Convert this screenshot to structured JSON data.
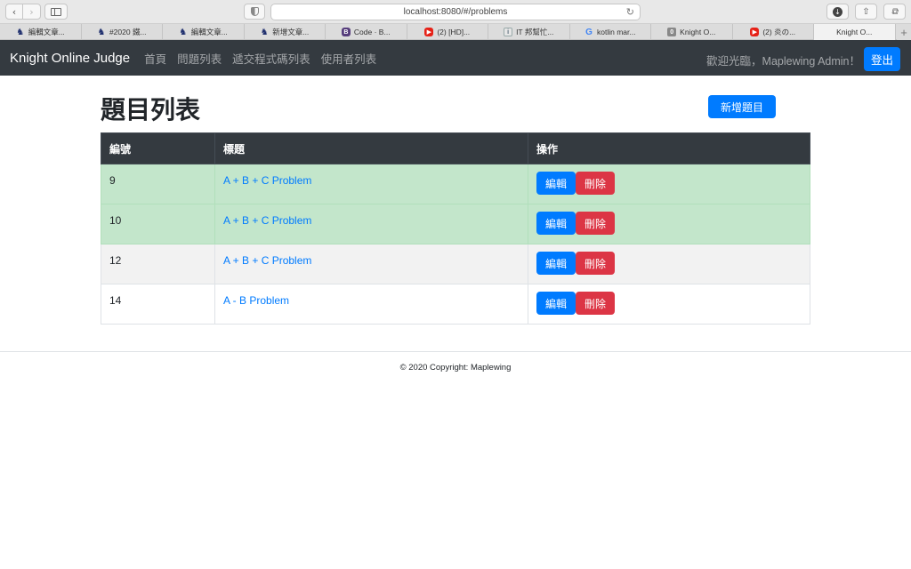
{
  "browser": {
    "url": "localhost:8080/#/problems",
    "reload_icon": "↻",
    "tabs": [
      {
        "label": "編輯文章...",
        "icon": "knight-icon",
        "glyph": "♞"
      },
      {
        "label": "#2020 鐵...",
        "icon": "knight-icon",
        "glyph": "♞"
      },
      {
        "label": "編輯文章...",
        "icon": "knight-icon",
        "glyph": "♞"
      },
      {
        "label": "新增文章...",
        "icon": "knight-icon",
        "glyph": "♞"
      },
      {
        "label": "Code · B...",
        "icon": "bootstrap-icon",
        "glyph": "B"
      },
      {
        "label": "(2) [HD]...",
        "icon": "youtube-icon",
        "glyph": "▶"
      },
      {
        "label": "IT 邦幫忙...",
        "icon": "ithelp-icon",
        "glyph": "i"
      },
      {
        "label": "kotlin mar...",
        "icon": "google-icon",
        "glyph": "G"
      },
      {
        "label": "Knight O...",
        "icon": "knight-oj-icon",
        "glyph": "0"
      },
      {
        "label": "(2) 炎の...",
        "icon": "youtube-icon",
        "glyph": "▶"
      },
      {
        "label": "Knight O...",
        "icon": "",
        "glyph": ""
      }
    ],
    "new_tab": "+"
  },
  "navbar": {
    "brand": "Knight Online Judge",
    "links": [
      "首頁",
      "問題列表",
      "遞交程式碼列表",
      "使用者列表"
    ],
    "welcome": "歡迎光臨，Maplewing Admin！",
    "logout": "登出"
  },
  "page": {
    "title": "題目列表",
    "add_button": "新增題目"
  },
  "table": {
    "headers": [
      "編號",
      "標題",
      "操作"
    ],
    "rows": [
      {
        "id": "9",
        "title": "A + B + C Problem",
        "edit": "編輯",
        "delete": "刪除"
      },
      {
        "id": "10",
        "title": "A + B + C Problem",
        "edit": "編輯",
        "delete": "刪除"
      },
      {
        "id": "12",
        "title": "A + B + C Problem",
        "edit": "編輯",
        "delete": "刪除"
      },
      {
        "id": "14",
        "title": "A - B Problem",
        "edit": "編輯",
        "delete": "刪除"
      }
    ]
  },
  "footer": "© 2020 Copyright: Maplewing",
  "colors": {
    "navbar": "#343a40",
    "primary": "#007bff",
    "danger": "#dc3545",
    "success_row": "#c3e6cb",
    "link": "#007bff"
  }
}
